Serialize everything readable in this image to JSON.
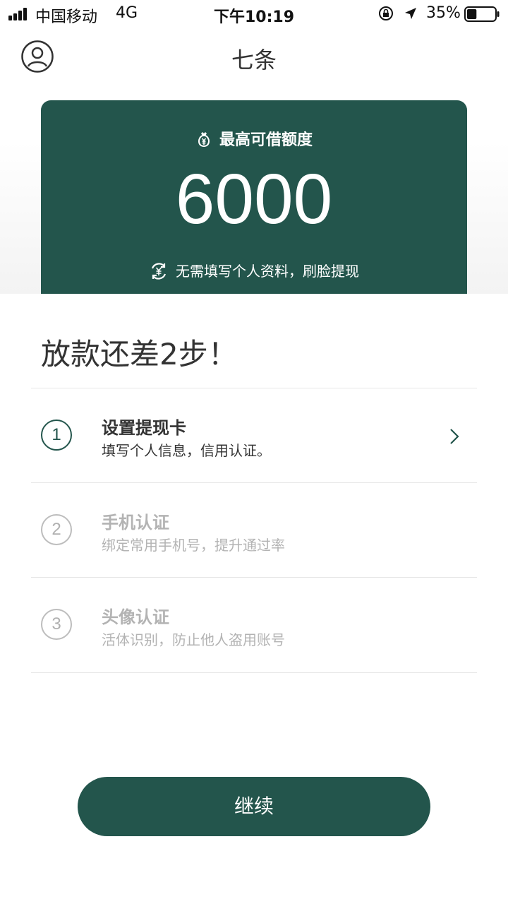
{
  "status_bar": {
    "carrier": "中国移动",
    "network": "4G",
    "time": "下午10:19",
    "battery_percent": "35%",
    "battery_level": 0.35,
    "icons": [
      "signal-icon",
      "orientation-lock-icon",
      "location-arrow-icon",
      "battery-icon"
    ]
  },
  "header": {
    "title": "七条",
    "left_icon": "user-avatar-icon"
  },
  "quota_card": {
    "label": "最高可借额度",
    "amount": "6000",
    "note": "无需填写个人资料，刷脸提现",
    "label_icon": "yuan-bag-icon",
    "note_icon": "yuan-refresh-icon"
  },
  "steps_heading": "放款还差2步！",
  "steps": [
    {
      "number": "1",
      "title": "设置提现卡",
      "desc": "填写个人信息，信用认证。",
      "active": true
    },
    {
      "number": "2",
      "title": "手机认证",
      "desc": "绑定常用手机号，提升通过率",
      "active": false
    },
    {
      "number": "3",
      "title": "头像认证",
      "desc": "活体识别，防止他人盗用账号",
      "active": false
    }
  ],
  "continue_button": {
    "label": "继续"
  },
  "colors": {
    "brand_green": "#23554c",
    "text_dark": "#333333",
    "text_disabled": "#b3b3b3",
    "divider": "#e6e6e6"
  }
}
